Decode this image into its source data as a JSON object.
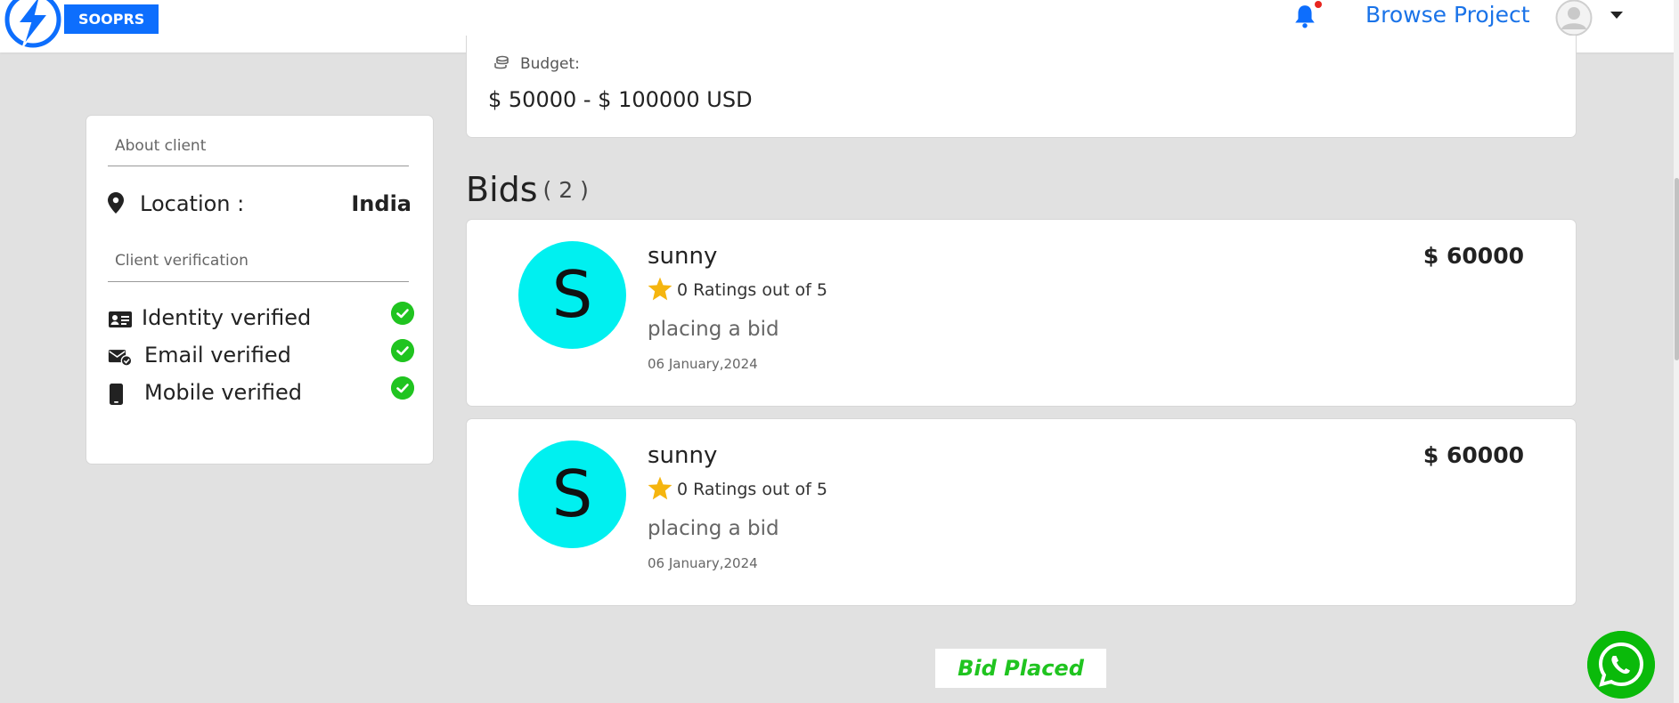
{
  "header": {
    "logo_text": "SOOPRS",
    "browse_label": "Browse Project",
    "colors": {
      "brand": "#0d6efd",
      "link": "#1a73e8",
      "notification_dot": "#e8251f"
    }
  },
  "project": {
    "budget_label": "Budget:",
    "budget_value": "$ 50000 - $ 100000 USD"
  },
  "client": {
    "about_heading": "About client",
    "location_label": "Location :",
    "location_value": "India",
    "verification_heading": "Client verification",
    "verifications": [
      {
        "label": "Identity verified",
        "icon": "id-card-icon",
        "verified": true
      },
      {
        "label": "Email verified",
        "icon": "envelope-check-icon",
        "verified": true
      },
      {
        "label": "Mobile verified",
        "icon": "mobile-phone-icon",
        "verified": true
      }
    ]
  },
  "bids": {
    "title": "Bids",
    "count_text": "( 2 )",
    "items": [
      {
        "initial": "S",
        "name": "sunny",
        "rating_text": "0 Ratings out of 5",
        "message": "placing a bid",
        "date": "06 January,2024",
        "amount": "$ 60000"
      },
      {
        "initial": "S",
        "name": "sunny",
        "rating_text": "0 Ratings out of 5",
        "message": "placing a bid",
        "date": "06 January,2024",
        "amount": "$ 60000"
      }
    ],
    "avatar_color": "#00f0f0"
  },
  "status": {
    "bid_placed_label": "Bid Placed",
    "color": "#20c420"
  },
  "icons": [
    "logo-icon",
    "bell-icon",
    "user-avatar-icon",
    "chevron-down-icon",
    "coins-icon",
    "location-pin-icon",
    "check-circle-icon",
    "star-icon",
    "whatsapp-icon"
  ]
}
